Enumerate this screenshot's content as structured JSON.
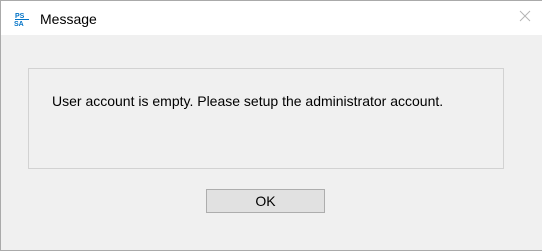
{
  "window": {
    "title": "Message",
    "app_icon": "psa-app-icon",
    "close_icon": "close-icon"
  },
  "dialog": {
    "message": "User account is empty. Please setup the administrator account.",
    "ok_label": "OK"
  },
  "colors": {
    "titlebar_bg": "#ffffff",
    "body_bg": "#f0f0f0",
    "button_bg": "#e1e1e1",
    "icon_blue": "#0072c6"
  }
}
